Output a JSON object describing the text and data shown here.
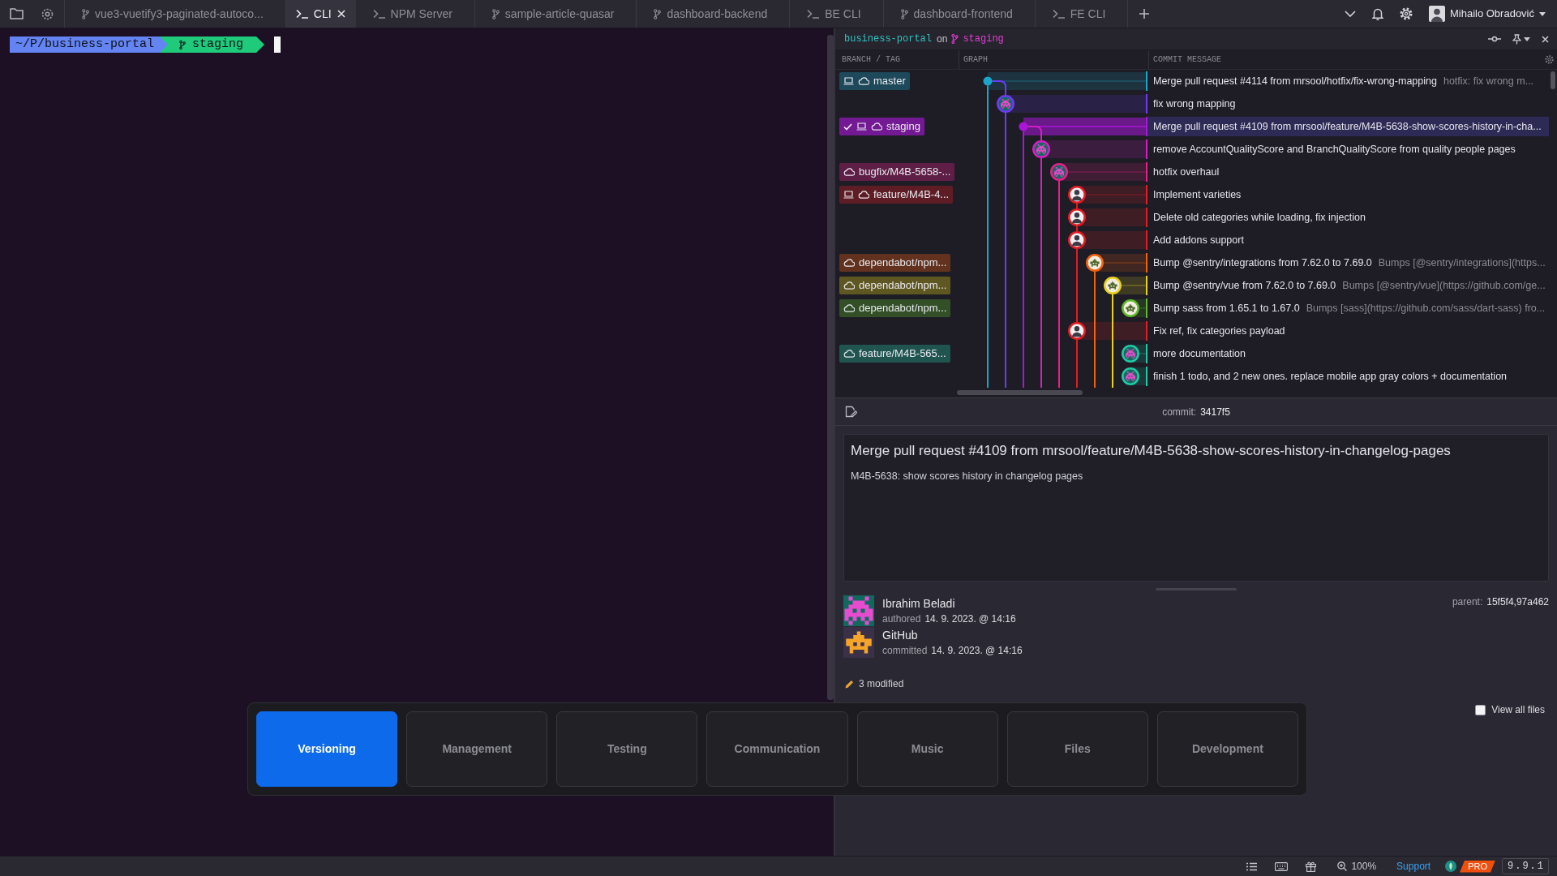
{
  "tabs_bar": {
    "tabs": [
      {
        "label": "vue3-vuetify3-paginated-autoco...",
        "kind": "repo",
        "selected": false
      },
      {
        "label": "CLI",
        "kind": "terminal",
        "selected": true
      },
      {
        "label": "NPM Server",
        "kind": "terminal",
        "selected": false
      },
      {
        "label": "sample-article-quasar",
        "kind": "repo",
        "selected": false
      },
      {
        "label": "dashboard-backend",
        "kind": "repo",
        "selected": false
      },
      {
        "label": "BE CLI",
        "kind": "terminal",
        "selected": false
      },
      {
        "label": "dashboard-frontend",
        "kind": "repo",
        "selected": false
      },
      {
        "label": "FE CLI",
        "kind": "terminal",
        "selected": false
      }
    ],
    "user": {
      "name": "Mihailo Obradović"
    }
  },
  "terminal": {
    "path": "~/P/business-portal",
    "branch": "staging"
  },
  "repo_header": {
    "repo": "business-portal",
    "joiner": "on",
    "branch": "staging"
  },
  "graph": {
    "columns": [
      "BRANCH / TAG",
      "GRAPH",
      "COMMIT MESSAGE"
    ],
    "commits": [
      {
        "kind": "merge",
        "color": "#1aa6c9",
        "selected": false,
        "branch": {
          "name": "master",
          "checked_out": false,
          "local": true,
          "remote": true
        },
        "message": "Merge pull request #4114 from mrsool/hotfix/fix-wrong-mapping",
        "description": "hotfix: fix wrong m..."
      },
      {
        "kind": "commit",
        "color": "#6b3cf5",
        "selected": false,
        "message": "fix wrong mapping"
      },
      {
        "kind": "merge",
        "color": "#a816d8",
        "selected": true,
        "branch": {
          "name": "staging",
          "checked_out": true,
          "local": true,
          "remote": true
        },
        "message": "Merge pull request #4109 from mrsool/feature/M4B-5638-show-scores-history-in-cha..."
      },
      {
        "kind": "commit",
        "color": "#d41fc4",
        "selected": false,
        "message": "remove AccountQualityScore and BranchQualityScore from quality people pages"
      },
      {
        "kind": "commit",
        "color": "#e6208a",
        "selected": false,
        "branch": {
          "name": "bugfix/M4B-5658-...",
          "checked_out": false,
          "local": false,
          "remote": true
        },
        "message": "hotfix overhaul"
      },
      {
        "kind": "commit",
        "color": "#e51c23",
        "selected": false,
        "branch": {
          "name": "feature/M4B-4...",
          "checked_out": false,
          "local": true,
          "remote": true
        },
        "message": "Implement varieties"
      },
      {
        "kind": "commit",
        "color": "#e51c23",
        "selected": false,
        "message": "Delete old categories while loading, fix injection"
      },
      {
        "kind": "commit",
        "color": "#e51c23",
        "selected": false,
        "message": "Add addons support"
      },
      {
        "kind": "commit",
        "color": "#f2600c",
        "selected": false,
        "branch": {
          "name": "dependabot/npm...",
          "checked_out": false,
          "local": false,
          "remote": true
        },
        "message": "Bump @sentry/integrations from 7.62.0 to 7.69.0",
        "description": "Bumps [@sentry/integrations](https..."
      },
      {
        "kind": "commit",
        "color": "#e8d21a",
        "selected": false,
        "branch": {
          "name": "dependabot/npm...",
          "checked_out": false,
          "local": false,
          "remote": true
        },
        "message": "Bump @sentry/vue from 7.62.0 to 7.69.0",
        "description": "Bumps [@sentry/vue](https://github.com/ge..."
      },
      {
        "kind": "commit",
        "color": "#5db82a",
        "selected": false,
        "branch": {
          "name": "dependabot/npm...",
          "checked_out": false,
          "local": false,
          "remote": true
        },
        "message": "Bump sass from 1.65.1 to 1.67.0",
        "description": "Bumps [sass](https://github.com/sass/dart-sass) fro..."
      },
      {
        "kind": "commit",
        "color": "#e51c23",
        "selected": false,
        "message": "Fix ref, fix categories payload"
      },
      {
        "kind": "commit",
        "color": "#20c9a5",
        "selected": false,
        "branch": {
          "name": "feature/M4B-565...",
          "checked_out": false,
          "local": false,
          "remote": true
        },
        "message": "more documentation"
      },
      {
        "kind": "commit",
        "color": "#20c9a5",
        "selected": false,
        "message": "finish 1 todo, and 2 new ones. replace mobile app gray colors + documentation"
      }
    ]
  },
  "commit_detail": {
    "commit_label": "commit:",
    "hash": "3417f5",
    "title": "Merge pull request #4109 from mrsool/feature/M4B-5638-show-scores-history-in-changelog-pages",
    "body": "M4B-5638: show scores history in changelog pages",
    "author": {
      "name": "Ibrahim Beladi",
      "action": "authored",
      "date": "14. 9. 2023. @ 14:16"
    },
    "committer": {
      "name": "GitHub",
      "action": "committed",
      "date": "14. 9. 2023. @ 14:16"
    },
    "parent_label": "parent:",
    "parents": "15f5f4,97a462",
    "changes": "3 modified",
    "view_all_files": {
      "label": "View all files",
      "checked": false
    }
  },
  "workspace_switcher": {
    "items": [
      {
        "label": "Versioning",
        "selected": true
      },
      {
        "label": "Management",
        "selected": false
      },
      {
        "label": "Testing",
        "selected": false
      },
      {
        "label": "Communication",
        "selected": false
      },
      {
        "label": "Music",
        "selected": false
      },
      {
        "label": "Files",
        "selected": false
      },
      {
        "label": "Development",
        "selected": false
      }
    ]
  },
  "status_bar": {
    "zoom": "100%",
    "support": "Support",
    "plan": "PRO",
    "version": "9.9.1"
  }
}
